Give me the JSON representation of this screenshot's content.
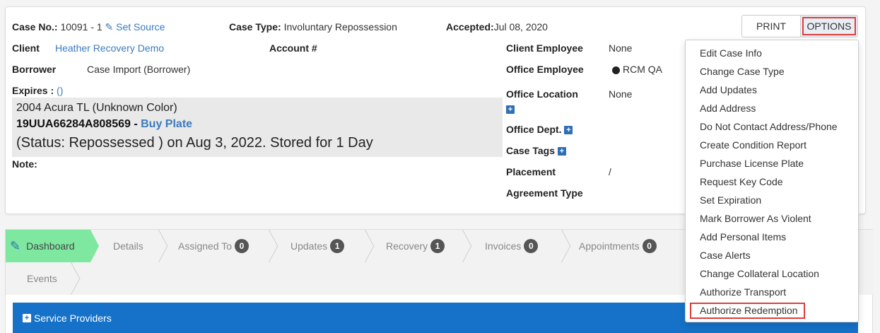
{
  "case": {
    "case_no_label": "Case No.:",
    "case_no_value": "10091 - 1",
    "set_source": "Set Source",
    "case_type_label": "Case Type:",
    "case_type_value": "Involuntary Repossession",
    "accepted_label": "Accepted:",
    "accepted_value": "Jul 08, 2020",
    "client_label": "Client",
    "client_value": "Heather Recovery Demo",
    "account_label": "Account #",
    "borrower_label": "Borrower",
    "borrower_value": "Case Import (Borrower)",
    "expires_label": "Expires :",
    "expires_value": "()",
    "note_label": "Note:"
  },
  "vehicle": {
    "line1": "2004 Acura TL (Unknown Color)",
    "vin": "19UUA66284A808569",
    "vin_sep": " - ",
    "buy_plate": "Buy Plate",
    "status_line": "(Status: Repossessed ) on Aug 3, 2022. Stored for 1 Day"
  },
  "right": {
    "client_employee_label": "Client Employee",
    "client_employee_value": "None",
    "office_employee_label": "Office Employee",
    "office_employee_value": "RCM QA",
    "office_location_label": "Office Location",
    "office_location_value": "None",
    "office_dept_label": "Office Dept.",
    "case_tags_label": "Case Tags",
    "placement_label": "Placement",
    "placement_value": "/",
    "agreement_type_label": "Agreement Type"
  },
  "buttons": {
    "print": "PRINT",
    "options": "OPTIONS"
  },
  "tabs": [
    {
      "label": "Dashboard",
      "badge": ""
    },
    {
      "label": "Details",
      "badge": ""
    },
    {
      "label": "Assigned To",
      "badge": "0"
    },
    {
      "label": "Updates",
      "badge": "1"
    },
    {
      "label": "Recovery",
      "badge": "1"
    },
    {
      "label": "Invoices",
      "badge": "0"
    },
    {
      "label": "Appointments",
      "badge": "0"
    },
    {
      "label": "Events",
      "badge": ""
    }
  ],
  "service_providers": "Service Providers",
  "options_menu": [
    "Edit Case Info",
    "Change Case Type",
    "Add Updates",
    "Add Address",
    "Do Not Contact Address/Phone",
    "Create Condition Report",
    "Purchase License Plate",
    "Request Key Code",
    "Set Expiration",
    "Mark Borrower As Violent",
    "Add Personal Items",
    "Case Alerts",
    "Change Collateral Location",
    "Authorize Transport",
    "Authorize Redemption"
  ],
  "colors": {
    "accent": "#3a7bbf",
    "active_tab": "#7ee8a1",
    "service_bar": "#1572c8",
    "highlight": "#e03c3c"
  }
}
